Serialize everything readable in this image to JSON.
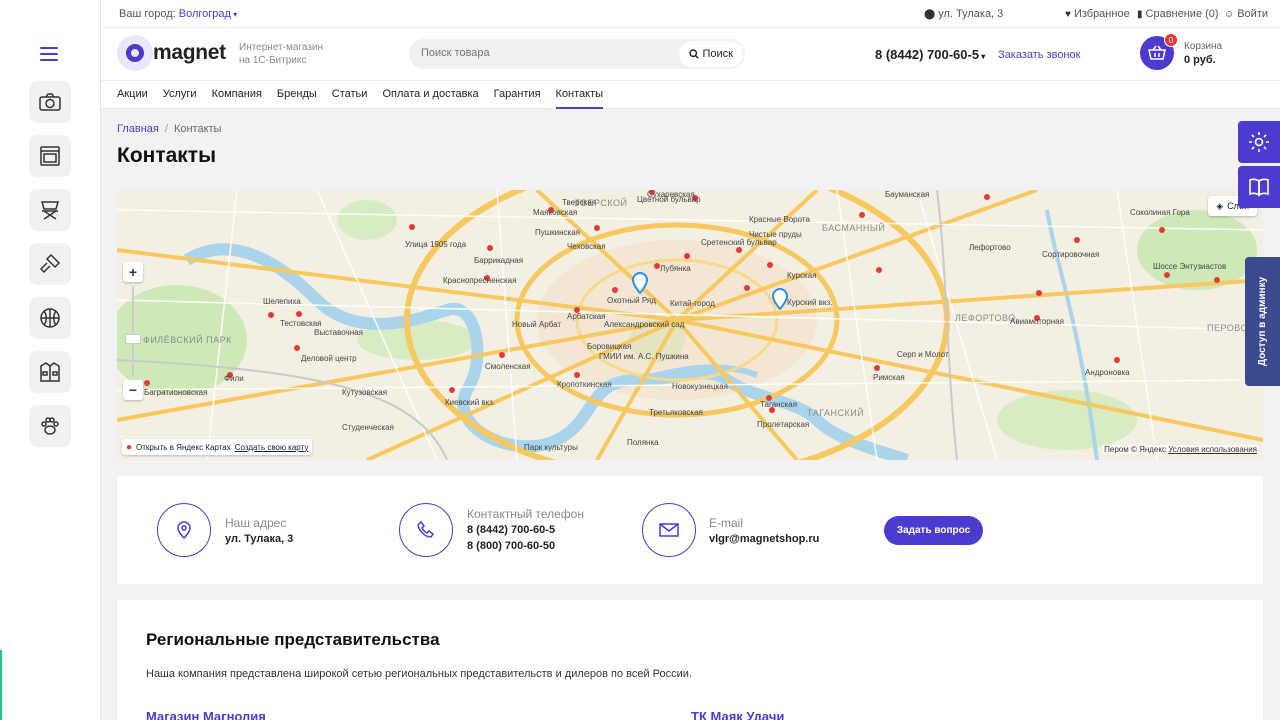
{
  "topbar": {
    "city_label": "Ваш город:",
    "city_value": "Волгоград",
    "address": "ул. Тулака, 3",
    "favorites": "Избранное",
    "compare": "Сравнение (0)",
    "login": "Войти"
  },
  "header": {
    "logo_text": "magnet",
    "tagline_1": "Интернет-магазин",
    "tagline_2": "на 1С-Битрикс",
    "search_placeholder": "Поиск товара",
    "search_button": "Поиск",
    "phone": "8 (8442) 700-60-5",
    "callback": "Заказать звонок",
    "cart_count": "0",
    "cart_label": "Корзина",
    "cart_sum": "0 руб."
  },
  "nav": [
    "Акции",
    "Услуги",
    "Компания",
    "Бренды",
    "Статьи",
    "Оплата и доставка",
    "Гарантия",
    "Контакты"
  ],
  "nav_active": "Контакты",
  "breadcrumb": {
    "home": "Главная",
    "sep": "/",
    "current": "Контакты"
  },
  "page_title": "Контакты",
  "map": {
    "layers": "Слои",
    "open_yandex": "Открыть в Яндекс Картах",
    "create_map": "Создать свою карту",
    "copyright": "Пером © Яндекс",
    "terms": "Условия использования",
    "districts": [
      "ТВЕРСКОЙ",
      "БАСМАННЫЙ",
      "ЛЕФОРТОВО",
      "ТАГАНСКИЙ",
      "ПЕРОВО",
      "ФИЛЁВСКИЙ ПАРК"
    ],
    "labels": [
      "Сухаревская",
      "Цветной бульвар",
      "Маяковская",
      "Пушкинская",
      "Тверская",
      "Чеховская",
      "Лубянка",
      "Охотный Ряд",
      "Китай-город",
      "Арбатская",
      "Смоленская",
      "Кропоткинская",
      "Курская",
      "Курский вкз.",
      "Таганская",
      "Пролетарская",
      "Бауманская",
      "Римская",
      "Авиамоторная",
      "Сортировочная",
      "Серп и Молот",
      "Улица 1905 года",
      "Баррикадная",
      "Краснопресненская",
      "Деловой центр",
      "Выставочная",
      "Киевский вкз.",
      "Студенческая",
      "Тестовская",
      "Фили",
      "Багратионовская",
      "Кутузовская",
      "Чистые пруды",
      "Красные Ворота",
      "Александровский сад",
      "Боровицкая",
      "ГМИИ им. А.С. Пушкина",
      "Третьяковская",
      "Новокузнецкая",
      "Полянка",
      "Шоссе Энтузиастов",
      "Соколиная Гора",
      "Андроновка",
      "Лефортово",
      "Новый Арбат",
      "Сретенский бульвар",
      "Парк культуры",
      "Шелепиха"
    ]
  },
  "contacts": {
    "address_label": "Наш адрес",
    "address_value": "ул. Тулака, 3",
    "phone_label": "Контактный телефон",
    "phone_1": "8 (8442) 700-60-5",
    "phone_2": "8 (800) 700-60-50",
    "email_label": "E-mail",
    "email_value": "vlgr@magnetshop.ru",
    "ask_button": "Задать вопрос"
  },
  "regional": {
    "title": "Региональные представительства",
    "text": "Наша компания представлена широкой сетью региональных представительств и дилеров по всей России.",
    "store_1": "Магазин Магнолия",
    "store_2": "ТК Маяк Удачи"
  },
  "accessibility_tab": "Доступ в админку",
  "colors": {
    "accent": "#4b3ccf",
    "badge": "#e53935",
    "admin_tab": "#3b4a8f",
    "rail_accent": "#1ec98b"
  },
  "icons": {
    "sidebar": [
      "camera-icon",
      "oven-icon",
      "chair-icon",
      "paint-roller-icon",
      "ball-icon",
      "jacket-icon",
      "paw-icon"
    ],
    "float": [
      "gear-icon",
      "book-icon"
    ]
  }
}
